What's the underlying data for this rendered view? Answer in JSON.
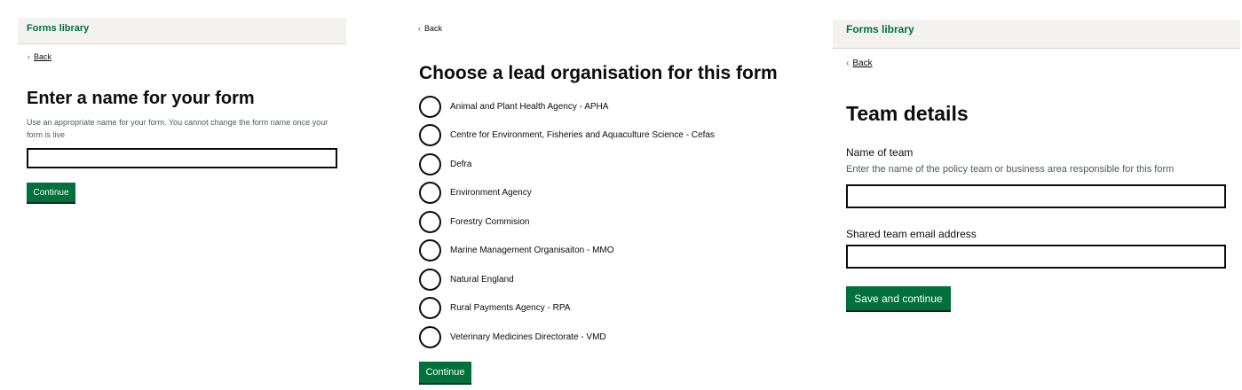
{
  "panel1": {
    "header_title": "Forms library",
    "back_label": "Back",
    "title": "Enter a name for your form",
    "hint": "Use an appropriate name for your form. You cannot change the form name once your form is live",
    "input_value": "",
    "continue_label": "Continue"
  },
  "panel2": {
    "back_label": "Back",
    "title": "Choose a lead organisation for this form",
    "options": [
      "Animal and Plant Health Agency - APHA",
      "Centre for Environment, Fisheries and Aquaculture Science - Cefas",
      "Defra",
      "Environment Agency",
      "Forestry Commision",
      "Marine Management Organisaiton - MMO",
      "Natural England",
      "Rural Payments Agency - RPA",
      "Veterinary Medicines Directorate - VMD"
    ],
    "continue_label": "Continue"
  },
  "panel3": {
    "header_title": "Forms library",
    "back_label": "Back",
    "title": "Team details",
    "team_label": "Name of team",
    "team_hint": "Enter the name of the policy team or business area responsible for this form",
    "team_value": "",
    "email_label": "Shared team email address",
    "email_value": "",
    "save_label": "Save and continue"
  },
  "colors": {
    "brand_green": "#00703c",
    "header_bg": "#f3f2f1",
    "text": "#0b0c0c",
    "hint_text": "#505a5f"
  },
  "icons": {
    "back": "chevron-left-icon"
  }
}
